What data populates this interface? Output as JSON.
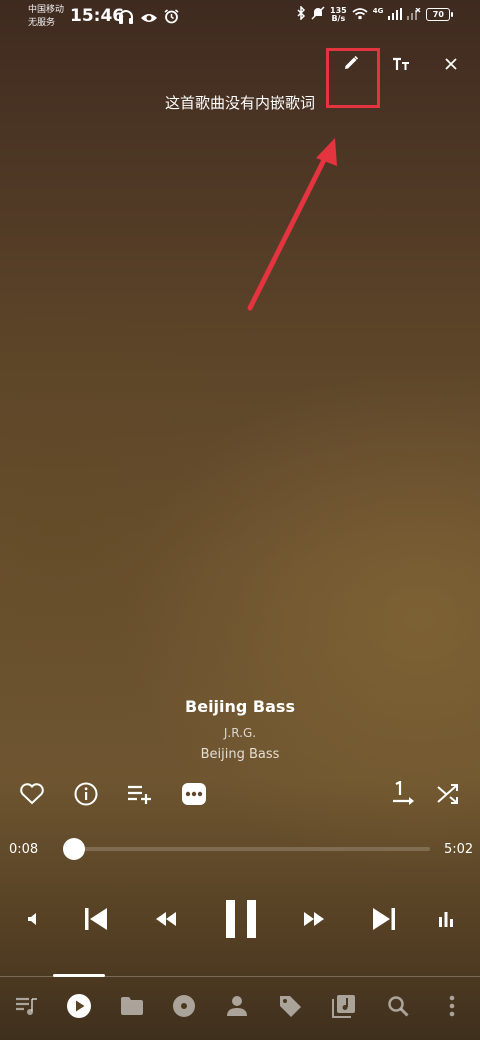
{
  "status_bar": {
    "carrier_line1": "中国移动",
    "carrier_line2": "无服务",
    "time": "15:46",
    "speed_value": "135",
    "speed_unit": "B/s",
    "network": "4G",
    "battery": "70",
    "left_icons": [
      "headphones-icon",
      "eye-icon",
      "alarm-icon"
    ],
    "right_icons": [
      "bluetooth-icon",
      "mute-icon",
      "wifi-icon",
      "signal-icon"
    ]
  },
  "lyrics": {
    "message": "这首歌曲没有内嵌歌词",
    "actions": [
      "edit-lyrics",
      "text-size",
      "close"
    ]
  },
  "annotation": {
    "color": "#e43440"
  },
  "song": {
    "title": "Beijing Bass",
    "artist": "J.R.G.",
    "album": "Beijing Bass"
  },
  "actions": [
    "favorite",
    "info",
    "add-to-playlist",
    "more",
    "repeat-one",
    "shuffle"
  ],
  "progress": {
    "current": "0:08",
    "total": "5:02",
    "fraction": 0.027
  },
  "transport": [
    "volume",
    "previous",
    "rewind",
    "pause",
    "fast-forward",
    "next",
    "equalizer"
  ],
  "nav": {
    "items": [
      "queue",
      "now-playing",
      "folders",
      "albums",
      "artists",
      "tags",
      "playlists",
      "search",
      "more"
    ],
    "active_index": 1
  }
}
